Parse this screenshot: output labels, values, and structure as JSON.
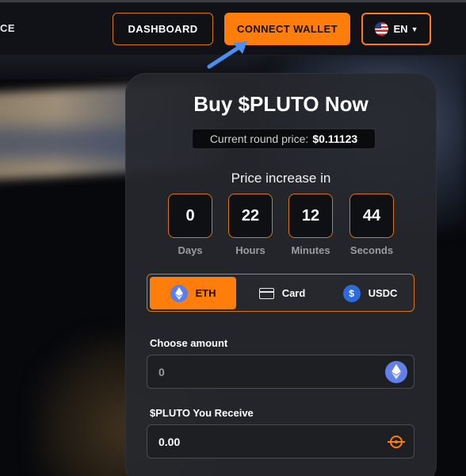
{
  "nav": {
    "left_text": "CE",
    "dashboard_label": "DASHBOARD",
    "connect_wallet_label": "CONNECT WALLET",
    "language_label": "EN"
  },
  "presale": {
    "title": "Buy $PLUTO Now",
    "round_price_label": "Current round price:",
    "round_price_value": "$0.11123",
    "increase_label": "Price increase in",
    "countdown": [
      {
        "value": "0",
        "label": "Days"
      },
      {
        "value": "22",
        "label": "Hours"
      },
      {
        "value": "12",
        "label": "Minutes"
      },
      {
        "value": "44",
        "label": "Seconds"
      }
    ],
    "payment_options": [
      {
        "label": "ETH",
        "icon": "ethereum-icon",
        "active": true
      },
      {
        "label": "Card",
        "icon": "credit-card-icon",
        "active": false
      },
      {
        "label": "USDC",
        "icon": "usdc-icon",
        "active": false
      }
    ],
    "amount_label": "Choose amount",
    "amount_placeholder": "0",
    "receive_label": "$PLUTO You Receive",
    "receive_value": "0.00"
  },
  "colors": {
    "accent": "#ff7d0a",
    "card_bg": "#26282e",
    "eth": "#6181e8"
  }
}
